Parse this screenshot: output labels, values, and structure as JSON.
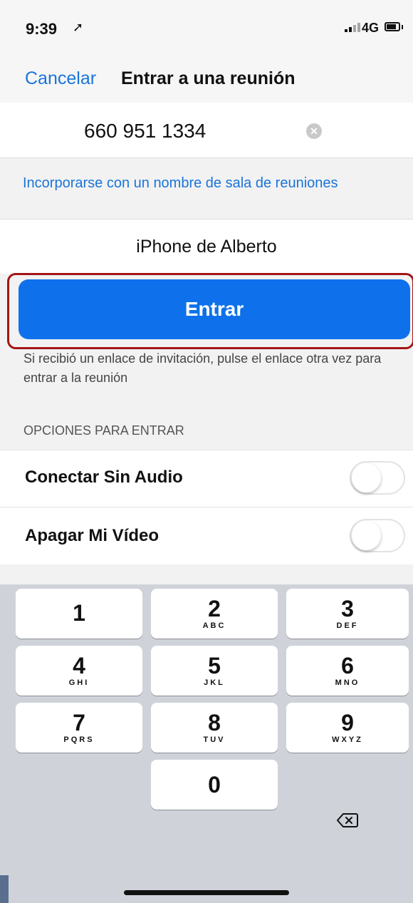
{
  "status": {
    "time": "9:39",
    "network": "4G",
    "icons": [
      "location-arrow-icon",
      "signal-icon",
      "battery-icon"
    ]
  },
  "nav": {
    "cancel": "Cancelar",
    "title": "Entrar a una reunión"
  },
  "meeting": {
    "id": "660 951 1334",
    "clear_icon": "clear-circle-icon"
  },
  "room_link": "Incorporarse con un nombre de sala de reuniones",
  "name_field": "iPhone de Alberto",
  "join_button": "Entrar",
  "hint": "Si recibió un enlace de invitación, pulse el enlace otra vez para entrar a la reunión",
  "options": {
    "header": "OPCIONES PARA ENTRAR",
    "items": [
      {
        "label": "Conectar Sin Audio",
        "enabled": false
      },
      {
        "label": "Apagar Mi Vídeo",
        "enabled": false
      }
    ]
  },
  "keypad": {
    "keys": [
      {
        "digit": "1",
        "letters": ""
      },
      {
        "digit": "2",
        "letters": "ABC"
      },
      {
        "digit": "3",
        "letters": "DEF"
      },
      {
        "digit": "4",
        "letters": "GHI"
      },
      {
        "digit": "5",
        "letters": "JKL"
      },
      {
        "digit": "6",
        "letters": "MNO"
      },
      {
        "digit": "7",
        "letters": "PQRS"
      },
      {
        "digit": "8",
        "letters": "TUV"
      },
      {
        "digit": "9",
        "letters": "WXYZ"
      },
      {
        "digit": "0",
        "letters": ""
      }
    ],
    "delete_icon": "backspace-icon"
  },
  "colors": {
    "accent": "#0e71eb",
    "link": "#1a74d9",
    "highlight": "#a31515",
    "keyboard_bg": "#cfd3d9"
  }
}
